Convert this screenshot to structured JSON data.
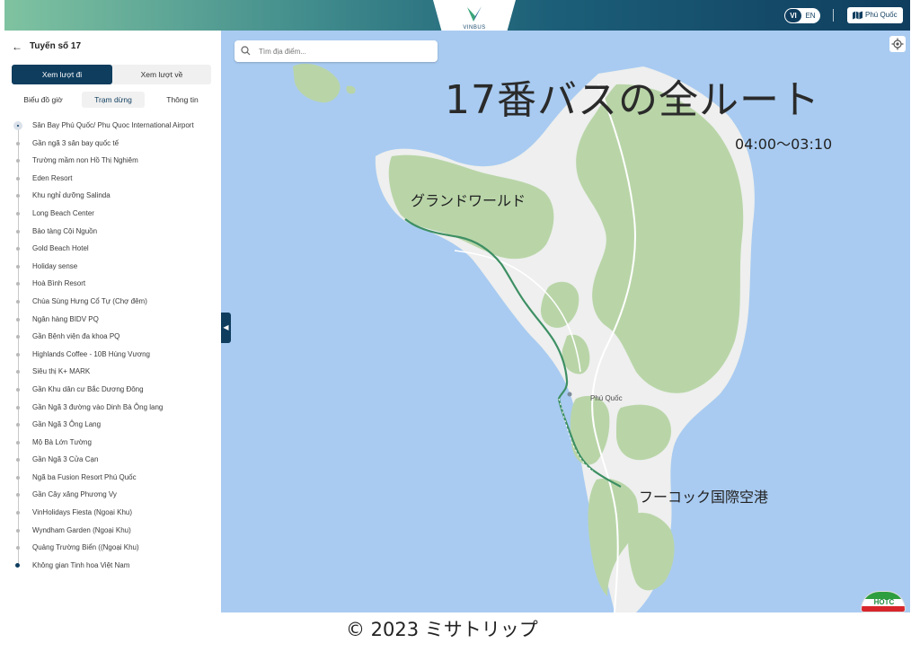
{
  "header": {
    "logo_text": "VINBUS",
    "lang_active": "VI",
    "lang_other": "EN",
    "city_button": "Phú Quốc",
    "accent_color": "#0f3d5e"
  },
  "sidebar": {
    "back_icon": "arrow-left-icon",
    "route_title": "Tuyến số 17",
    "direction_tabs": [
      "Xem lượt đi",
      "Xem lượt về"
    ],
    "sub_tabs": [
      "Biểu đồ giờ",
      "Trạm dừng",
      "Thông tin"
    ],
    "stops": [
      "Sân Bay Phú Quốc/ Phu Quoc International Airport",
      "Gần ngã 3 sân bay quốc tế",
      "Trường mầm non Hồ Thị Nghiêm",
      "Eden Resort",
      "Khu nghỉ dưỡng Salinda",
      "Long Beach Center",
      "Bảo tàng Cội Nguồn",
      "Gold Beach Hotel",
      "Holiday sense",
      "Hoà Bình Resort",
      "Chùa Sùng Hưng Cổ Tự (Chợ đêm)",
      "Ngân hàng BIDV PQ",
      "Gần Bệnh viện đa khoa PQ",
      "Highlands Coffee - 10B Hùng Vương",
      "Siêu thị K+ MARK",
      "Gần Khu dân cư Bắc Dương Đông",
      "Gần Ngã 3 đường vào Dinh Bà Ông lang",
      "Gần Ngã 3 Ông Lang",
      "Mộ Bà Lớn Tường",
      "Gần Ngã 3 Cửa Cạn",
      "Ngã ba Fusion Resort Phú Quốc",
      "Gần Cây xăng Phương Vy",
      "VinHolidays Fiesta (Ngoại Khu)",
      "Wyndham Garden (Ngoại Khu)",
      "Quảng Trường Biển ((Ngoại Khu)",
      "Không gian Tinh hoa Việt Nam"
    ]
  },
  "map": {
    "search_placeholder": "Tìm địa điểm...",
    "city_label": "Phú Quốc",
    "collapse_icon": "chevron-left-icon",
    "locate_icon": "crosshair-icon",
    "sea_color": "#a9cbf1",
    "forest_color": "#b9d5a8",
    "route_color": "#3d8f63"
  },
  "overlay": {
    "title": "17番バスの全ルート",
    "hours": "04:00～03:10",
    "label_grandworld": "グランドワールド",
    "label_airport": "フーコック国際空港",
    "badge": "HOTC"
  },
  "footer": {
    "copyright": "© 2023 ミサトリップ"
  }
}
